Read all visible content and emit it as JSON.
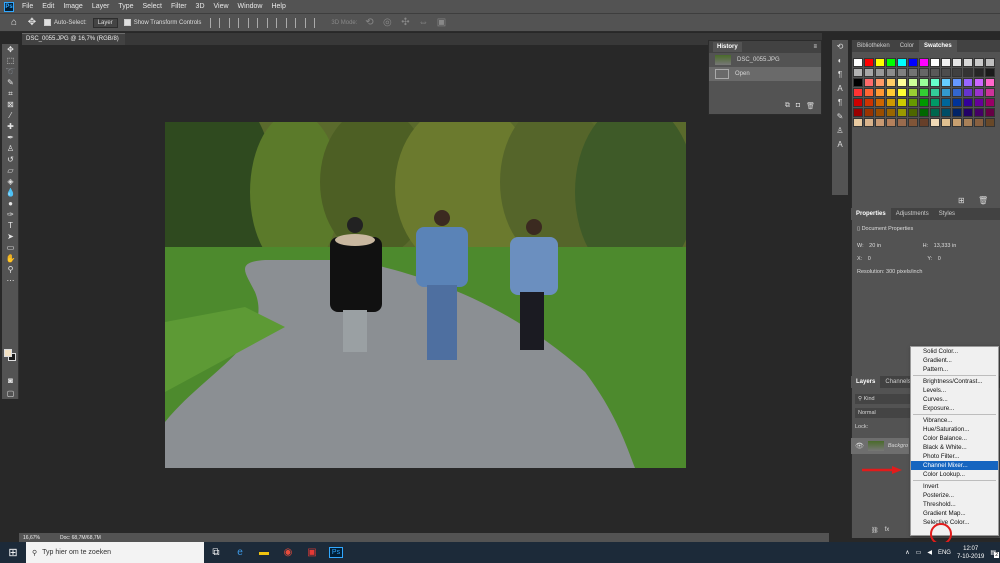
{
  "app": {
    "logo": "Ps",
    "menus": [
      "File",
      "Edit",
      "Image",
      "Layer",
      "Type",
      "Select",
      "Filter",
      "3D",
      "View",
      "Window",
      "Help"
    ]
  },
  "options": {
    "auto_select_label": "Auto-Select:",
    "auto_select_value": "Layer",
    "transform_label": "Show Transform Controls",
    "mode3d_label": "3D Mode:"
  },
  "document": {
    "tab_title": "DSC_0055.JPG @ 16,7% (RGB/8)",
    "zoom": "16,67%",
    "doc_info": "Doc: 68,7M/68,7M"
  },
  "history": {
    "title": "History",
    "snapshot": "DSC_0055.JPG",
    "step": "Open"
  },
  "swatches_panel": {
    "tabs": [
      "Bibliotheken",
      "Color",
      "Swatches"
    ],
    "active": "Swatches",
    "colors": [
      "#ffffff",
      "#ff0000",
      "#ffff00",
      "#00ff00",
      "#00ffff",
      "#0000ff",
      "#ff00ff",
      "#ffffff",
      "#f2f2f2",
      "#e6e6e6",
      "#d9d9d9",
      "#cccccc",
      "#bfbfbf",
      "#b3b3b3",
      "#a6a6a6",
      "#999999",
      "#8c8c8c",
      "#808080",
      "#737373",
      "#666666",
      "#595959",
      "#4d4d4d",
      "#404040",
      "#333333",
      "#262626",
      "#1a1a1a",
      "#000000",
      "#ff6b6b",
      "#ff9966",
      "#ffcc66",
      "#ffff99",
      "#ccff99",
      "#99ff99",
      "#66ffcc",
      "#66ccff",
      "#6699ff",
      "#9966ff",
      "#cc66ff",
      "#ff66cc",
      "#ff3333",
      "#ff6633",
      "#ff9933",
      "#ffcc33",
      "#ffff33",
      "#99cc33",
      "#33cc33",
      "#33cc99",
      "#3399cc",
      "#3366cc",
      "#6633cc",
      "#9933cc",
      "#cc3399",
      "#cc0000",
      "#cc3300",
      "#cc6600",
      "#cc9900",
      "#cccc00",
      "#669900",
      "#009900",
      "#009966",
      "#006699",
      "#003399",
      "#330099",
      "#660099",
      "#990066",
      "#990000",
      "#993300",
      "#994d00",
      "#996600",
      "#999900",
      "#4d6600",
      "#006600",
      "#00664d",
      "#004d66",
      "#002266",
      "#220066",
      "#440066",
      "#660044",
      "#e8c9a0",
      "#d9b38c",
      "#c99a73",
      "#b3805c",
      "#996b4d",
      "#805538",
      "#663f29",
      "#f0d9b5",
      "#e0c090",
      "#c8a070",
      "#a88058",
      "#886040",
      "#684828"
    ]
  },
  "properties": {
    "tabs": [
      "Properties",
      "Adjustments",
      "Styles"
    ],
    "active": "Properties",
    "section": "Document Properties",
    "w_label": "W:",
    "w_value": "20 in",
    "h_label": "H:",
    "h_value": "13,333 in",
    "x_label": "X:",
    "x_value": "0",
    "y_label": "Y:",
    "y_value": "0",
    "resolution": "Resolution: 300 pixels/inch"
  },
  "layers": {
    "tabs": [
      "Layers",
      "Channels"
    ],
    "active": "Layers",
    "kind_placeholder": "Kind",
    "blend": "Normal",
    "lock_label": "Lock:",
    "layer_name": "Backgro"
  },
  "adjustment_menu": {
    "groups": [
      [
        "Solid Color...",
        "Gradient...",
        "Pattern..."
      ],
      [
        "Brightness/Contrast...",
        "Levels...",
        "Curves...",
        "Exposure..."
      ],
      [
        "Vibrance...",
        "Hue/Saturation...",
        "Color Balance...",
        "Black & White...",
        "Photo Filter...",
        "Channel Mixer...",
        "Color Lookup..."
      ],
      [
        "Invert",
        "Posterize...",
        "Threshold...",
        "Gradient Map...",
        "Selective Color..."
      ]
    ],
    "highlighted": "Channel Mixer..."
  },
  "taskbar": {
    "search_placeholder": "Typ hier om te zoeken",
    "lang": "ENG",
    "time": "12:07",
    "date": "7-10-2019",
    "notif_count": "2"
  }
}
